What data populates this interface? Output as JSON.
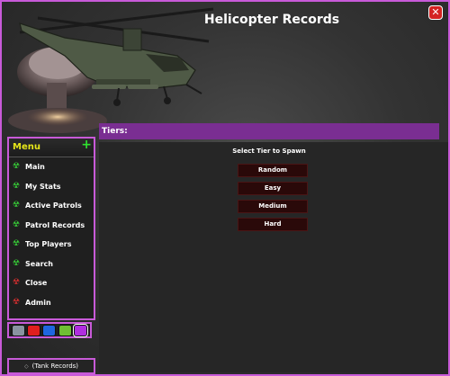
{
  "window": {
    "title": "Helicopter Records",
    "close_label": "✕"
  },
  "menu": {
    "title": "Menu",
    "add_label": "+",
    "items": [
      {
        "label": "Main",
        "status": "green"
      },
      {
        "label": "My Stats",
        "status": "green"
      },
      {
        "label": "Active Patrols",
        "status": "green"
      },
      {
        "label": "Patrol Records",
        "status": "green"
      },
      {
        "label": "Top Players",
        "status": "green"
      },
      {
        "label": "Search",
        "status": "green"
      },
      {
        "label": "Close",
        "status": "red"
      },
      {
        "label": "Admin",
        "status": "red"
      }
    ],
    "item_icon": "radiation-icon"
  },
  "themes": {
    "swatches": [
      {
        "name": "gray",
        "color": "#8a93a0"
      },
      {
        "name": "red",
        "color": "#e01e1e"
      },
      {
        "name": "blue",
        "color": "#1f66e0"
      },
      {
        "name": "green",
        "color": "#6fbe33"
      },
      {
        "name": "purple",
        "color": "#b02ee0",
        "selected": true
      }
    ]
  },
  "footer": {
    "tank_button": "(Tank Records)"
  },
  "tiers": {
    "header": "Tiers:",
    "prompt": "Select Tier to Spawn",
    "buttons": [
      "Random",
      "Easy",
      "Medium",
      "Hard"
    ]
  },
  "colors": {
    "accent": "#c85ad8",
    "header_bar": "#7a2e92",
    "menu_title": "#e6e61a"
  }
}
